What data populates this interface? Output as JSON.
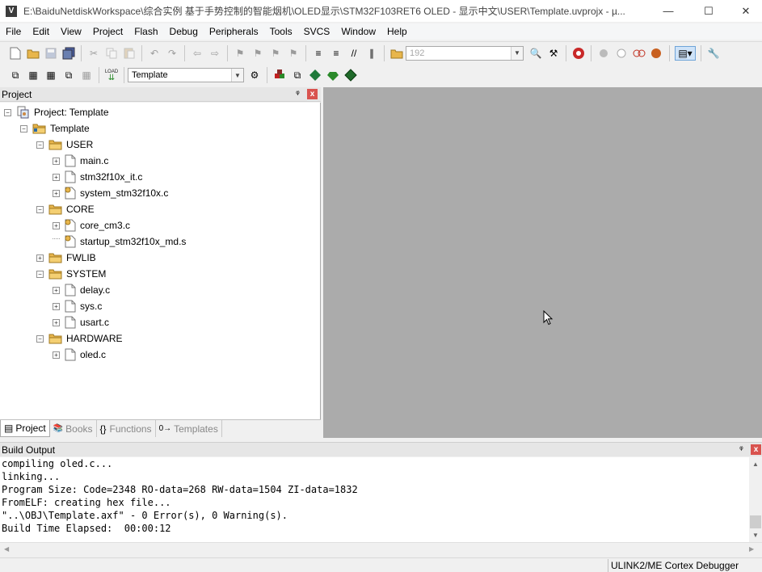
{
  "window": {
    "title": "E:\\BaiduNetdiskWorkspace\\综合实例 基于手势控制的智能烟机\\OLED显示\\STM32F103RET6 OLED - 显示中文\\USER\\Template.uvprojx - µ...",
    "logo": "V",
    "minimize": "—",
    "maximize": "☐",
    "close": "✕"
  },
  "menu": [
    "File",
    "Edit",
    "View",
    "Project",
    "Flash",
    "Debug",
    "Peripherals",
    "Tools",
    "SVCS",
    "Window",
    "Help"
  ],
  "toolbar": {
    "find_combo_value": "192",
    "target_combo_value": "Template",
    "load_label": "LOAD"
  },
  "project_panel": {
    "title": "Project",
    "pin": "ᵠ",
    "close": "x",
    "tree": [
      {
        "label": "Project: Template",
        "toggle": "−",
        "icon": "project"
      },
      {
        "label": "Template",
        "toggle": "−",
        "icon": "target"
      },
      {
        "label": "USER",
        "toggle": "−",
        "icon": "folder"
      },
      {
        "label": "main.c",
        "toggle": "+",
        "icon": "file"
      },
      {
        "label": "stm32f10x_it.c",
        "toggle": "+",
        "icon": "file"
      },
      {
        "label": "system_stm32f10x.c",
        "toggle": "+",
        "icon": "file-key"
      },
      {
        "label": "CORE",
        "toggle": "−",
        "icon": "folder"
      },
      {
        "label": "core_cm3.c",
        "toggle": "+",
        "icon": "file-key"
      },
      {
        "label": "startup_stm32f10x_md.s",
        "toggle": "",
        "icon": "file-key"
      },
      {
        "label": "FWLIB",
        "toggle": "+",
        "icon": "folder"
      },
      {
        "label": "SYSTEM",
        "toggle": "−",
        "icon": "folder"
      },
      {
        "label": "delay.c",
        "toggle": "+",
        "icon": "file"
      },
      {
        "label": "sys.c",
        "toggle": "+",
        "icon": "file"
      },
      {
        "label": "usart.c",
        "toggle": "+",
        "icon": "file"
      },
      {
        "label": "HARDWARE",
        "toggle": "−",
        "icon": "folder"
      },
      {
        "label": "oled.c",
        "toggle": "+",
        "icon": "file"
      }
    ],
    "tabs": [
      {
        "label": "Project",
        "icon": "▤"
      },
      {
        "label": "Books",
        "icon": "📚"
      },
      {
        "label": "Functions",
        "icon": "{}"
      },
      {
        "label": "Templates",
        "icon": "0→"
      }
    ]
  },
  "build_output": {
    "title": "Build Output",
    "pin": "ᵠ",
    "close": "x",
    "lines": [
      "compiling oled.c...",
      "linking...",
      "Program Size: Code=2348 RO-data=268 RW-data=1504 ZI-data=1832",
      "FromELF: creating hex file...",
      "\"..\\OBJ\\Template.axf\" - 0 Error(s), 0 Warning(s).",
      "Build Time Elapsed:  00:00:12"
    ]
  },
  "status": {
    "debugger": "ULINK2/ME Cortex Debugger"
  },
  "colors": {
    "editor_bg": "#ababab",
    "folder": "#e8b64c",
    "close_red": "#d9534f"
  }
}
